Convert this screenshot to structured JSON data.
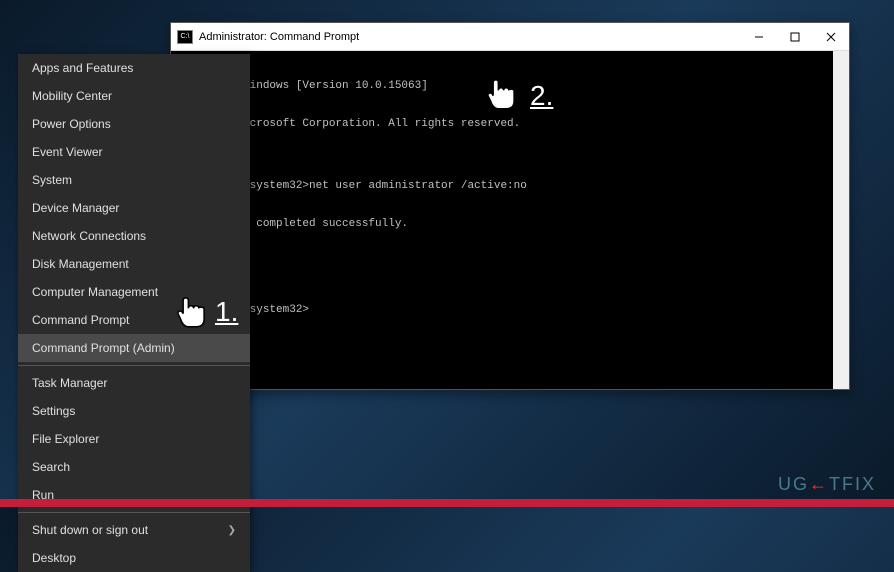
{
  "context_menu": {
    "items": [
      {
        "label": "Apps and Features"
      },
      {
        "label": "Mobility Center"
      },
      {
        "label": "Power Options"
      },
      {
        "label": "Event Viewer"
      },
      {
        "label": "System"
      },
      {
        "label": "Device Manager"
      },
      {
        "label": "Network Connections"
      },
      {
        "label": "Disk Management"
      },
      {
        "label": "Computer Management"
      },
      {
        "label": "Command Prompt"
      },
      {
        "label": "Command Prompt (Admin)"
      }
    ],
    "items2": [
      {
        "label": "Task Manager"
      },
      {
        "label": "Settings"
      },
      {
        "label": "File Explorer"
      },
      {
        "label": "Search"
      },
      {
        "label": "Run"
      }
    ],
    "items3": [
      {
        "label": "Shut down or sign out"
      },
      {
        "label": "Desktop"
      }
    ]
  },
  "cmd_window": {
    "title": "Administrator: Command Prompt",
    "lines": {
      "l1": "Microsoft Windows [Version 10.0.15063]",
      "l2": "(c) 2017 Microsoft Corporation. All rights reserved.",
      "l3": "",
      "l4": "C:\\WINDOWS\\system32>net user administrator /active:no",
      "l5": "The command completed successfully.",
      "l6": "",
      "l7": "",
      "l8": "C:\\WINDOWS\\system32>"
    }
  },
  "annotations": {
    "label1": "1.",
    "label2": "2."
  },
  "watermark": {
    "pre": "UG",
    "arrow": "←",
    "post": "TFIX"
  }
}
